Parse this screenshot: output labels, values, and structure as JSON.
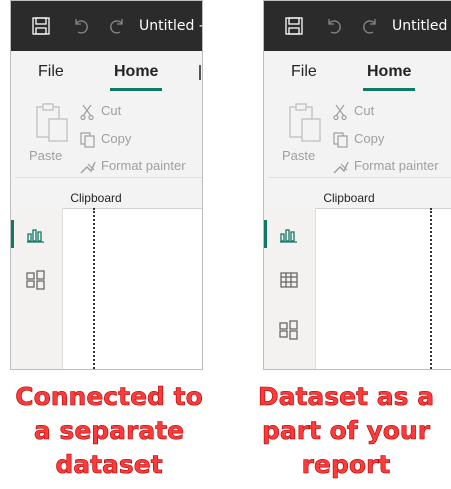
{
  "panels": [
    {
      "title": "Untitled -",
      "tabs": {
        "file": "File",
        "home": "Home"
      },
      "clipboard": {
        "paste": "Paste",
        "cut": "Cut",
        "copy": "Copy",
        "format_painter": "Format painter",
        "group_label": "Clipboard"
      },
      "sidebar_icons": [
        "report-view-icon",
        "model-view-icon"
      ],
      "caption": [
        "Connected to",
        "a separate",
        "dataset"
      ]
    },
    {
      "title": "Untitled -",
      "tabs": {
        "file": "File",
        "home": "Home"
      },
      "clipboard": {
        "paste": "Paste",
        "cut": "Cut",
        "copy": "Copy",
        "format_painter": "Format painter",
        "group_label": "Clipboard"
      },
      "sidebar_icons": [
        "report-view-icon",
        "data-view-icon",
        "model-view-icon"
      ],
      "caption": [
        "Dataset as a",
        "part of your",
        "report"
      ]
    }
  ],
  "colors": {
    "accent": "#117865",
    "titlebar": "#2b2b2b",
    "caption": "#ff3a3a"
  }
}
